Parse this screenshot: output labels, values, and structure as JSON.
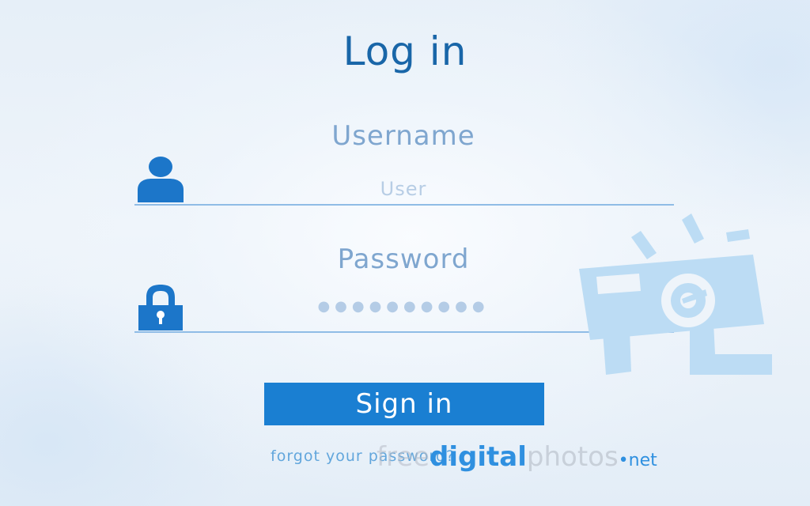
{
  "login": {
    "title": "Log in",
    "username_label": "Username",
    "username_placeholder": "User",
    "password_label": "Password",
    "password_masked": "●●●●●●●●●●",
    "signin_label": "Sign in",
    "forgot_link": "forgot your password?"
  },
  "watermark": {
    "part1": "free",
    "part2": "digital",
    "part3": "photos",
    "part4": "•net"
  },
  "colors": {
    "accent": "#1a7fd2",
    "title": "#1966a8",
    "label": "#7fa6cf",
    "icon": "#1c76c9",
    "underline": "#8fbce6",
    "mascot": "#bcdcf4"
  },
  "icons": {
    "user": "user-icon",
    "lock": "lock-icon",
    "mascot": "mascot-logo"
  }
}
